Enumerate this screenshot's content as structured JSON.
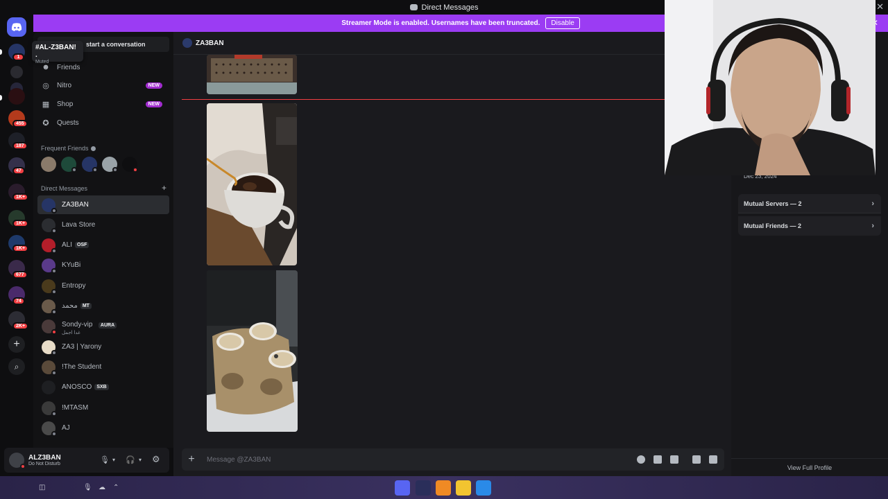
{
  "window": {
    "title": "Direct Messages",
    "close": "✕"
  },
  "banner": {
    "text": "Streamer Mode is enabled. Usernames have been truncated.",
    "disable_label": "Disable",
    "close": "✕"
  },
  "rail": {
    "badges": [
      "1",
      "455",
      "187",
      "47",
      "1K+",
      "1K+",
      "1K+",
      "677",
      "74",
      "2K+"
    ],
    "add": "+",
    "discover": "⌕"
  },
  "sidebar": {
    "search_text": "start a conversation",
    "tooltip_name": "#AL-Z3BAN! .",
    "tooltip_sub": "Muted",
    "nav": [
      {
        "label": "Friends",
        "icon": "friends-icon"
      },
      {
        "label": "Nitro",
        "icon": "nitro-icon",
        "badge": "NEW"
      },
      {
        "label": "Shop",
        "icon": "shop-icon",
        "badge": "NEW"
      },
      {
        "label": "Quests",
        "icon": "quests-icon"
      }
    ],
    "frequent_label": "Frequent Friends",
    "dm_label": "Direct Messages",
    "dm_add": "+",
    "dms": [
      {
        "name": "ZA3BAN",
        "active": true
      },
      {
        "name": "Lava Store"
      },
      {
        "name": "ALI",
        "tag": "OSF"
      },
      {
        "name": "KYuBi"
      },
      {
        "name": "Entropy"
      },
      {
        "name": "محمد",
        "tag": "MT"
      },
      {
        "name": "Sondy-vip",
        "tag": "AURA",
        "sub": "غدا اجمل"
      },
      {
        "name": "ZA3 | Yarony"
      },
      {
        "name": "!The Student"
      },
      {
        "name": "ANOSCO",
        "tag": "SXB"
      },
      {
        "name": "!MTASM"
      },
      {
        "name": "AJ"
      }
    ]
  },
  "user": {
    "name": "ALZ3BAN",
    "status": "Do Not Disturb"
  },
  "chat": {
    "recipient": "ZA3BAN",
    "composer_placeholder": "Message @ZA3BAN",
    "composer_plus": "+"
  },
  "profile": {
    "since": "Dec 23, 2024",
    "mutual_servers": "Mutual Servers — 2",
    "mutual_friends": "Mutual Friends — 2",
    "view_full": "View Full Profile",
    "chevron": "›"
  },
  "colors": {
    "brand": "#5865f2",
    "banner": "#9b3cf3",
    "badge": "#f23f43",
    "nitro_badge": "#a22dd0"
  }
}
